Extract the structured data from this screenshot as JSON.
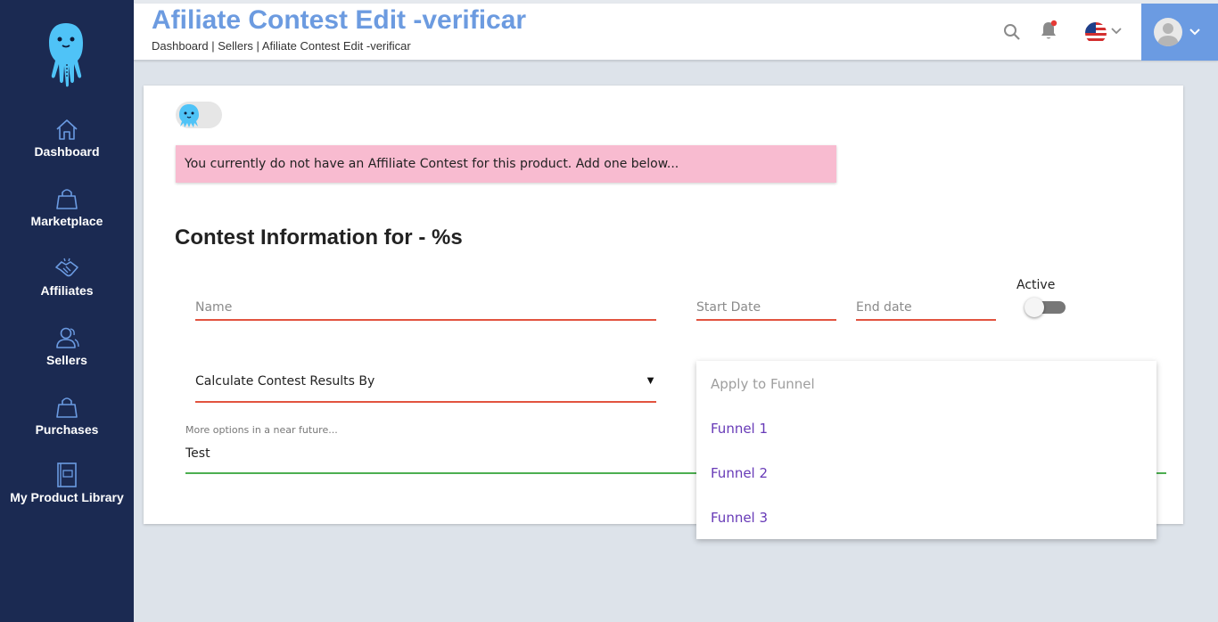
{
  "sidebar": {
    "items": [
      {
        "label": "Dashboard",
        "icon": "home-icon"
      },
      {
        "label": "Marketplace",
        "icon": "shopping-bag-icon"
      },
      {
        "label": "Affiliates",
        "icon": "handshake-icon"
      },
      {
        "label": "Sellers",
        "icon": "users-icon"
      },
      {
        "label": "Purchases",
        "icon": "shopping-bag-icon"
      },
      {
        "label": "My Product Library",
        "icon": "book-icon"
      }
    ]
  },
  "header": {
    "title": "Afiliate Contest Edit -verificar",
    "breadcrumb": "Dashboard | Sellers | Afiliate Contest Edit -verificar"
  },
  "alert": {
    "text": "You currently do not have an Affiliate Contest for this product. Add one below..."
  },
  "form": {
    "section_title": "Contest Information for - %s",
    "name_placeholder": "Name",
    "start_date_placeholder": "Start Date",
    "end_date_placeholder": "End date",
    "active_label": "Active",
    "active_on": false,
    "calculate_select": "Calculate Contest Results By",
    "calculate_caret": "▼",
    "hint": "More options in a near future...",
    "test_value": "Test"
  },
  "funnel_menu": {
    "header": "Apply to Funnel",
    "options": [
      "Funnel 1",
      "Funnel 2",
      "Funnel 3"
    ]
  },
  "colors": {
    "sidebar_bg": "#1b2a52",
    "title_blue": "#6c9be0",
    "error_underline": "#e2533f",
    "success_underline": "#4caf50",
    "alert_bg": "#f8bbd0",
    "menu_option": "#673ab7"
  }
}
